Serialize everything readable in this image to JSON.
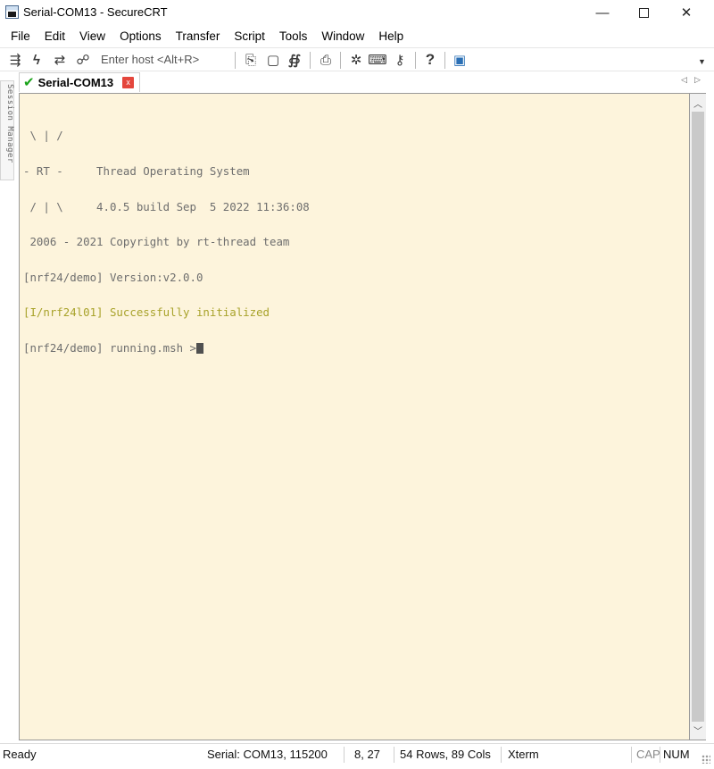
{
  "window": {
    "title": "Serial-COM13 - SecureCRT",
    "minimize": "—",
    "close": "✕"
  },
  "menu": [
    "File",
    "Edit",
    "View",
    "Options",
    "Transfer",
    "Script",
    "Tools",
    "Window",
    "Help"
  ],
  "toolbar": {
    "host_placeholder": "Enter host <Alt+R>",
    "icons": [
      "connect-icon",
      "quick-connect-icon",
      "reconnect-icon",
      "disconnect-icon",
      "copy-icon",
      "paste-icon",
      "find-icon",
      "print-icon",
      "settings-icon",
      "keymap-icon",
      "key-icon",
      "help-icon",
      "screen-icon"
    ]
  },
  "session_manager": {
    "label": "Session Manager"
  },
  "tab": {
    "label": "Serial-COM13",
    "close_glyph": "x"
  },
  "terminal": {
    "background": "#fdf4dc",
    "lines": [
      " \\ | /",
      "- RT -     Thread Operating System",
      " / | \\     4.0.5 build Sep  5 2022 11:36:08",
      " 2006 - 2021 Copyright by rt-thread team",
      "[nrf24/demo] Version:v2.0.0",
      "[I/nrf24l01] Successfully initialized",
      "[nrf24/demo] running.msh >"
    ]
  },
  "status": {
    "state": "Ready",
    "connection": "Serial: COM13, 115200",
    "cursor_pos": "8, 27",
    "size": "54 Rows, 89 Cols",
    "emulation": "Xterm",
    "cap": "CAP",
    "num": "NUM"
  }
}
